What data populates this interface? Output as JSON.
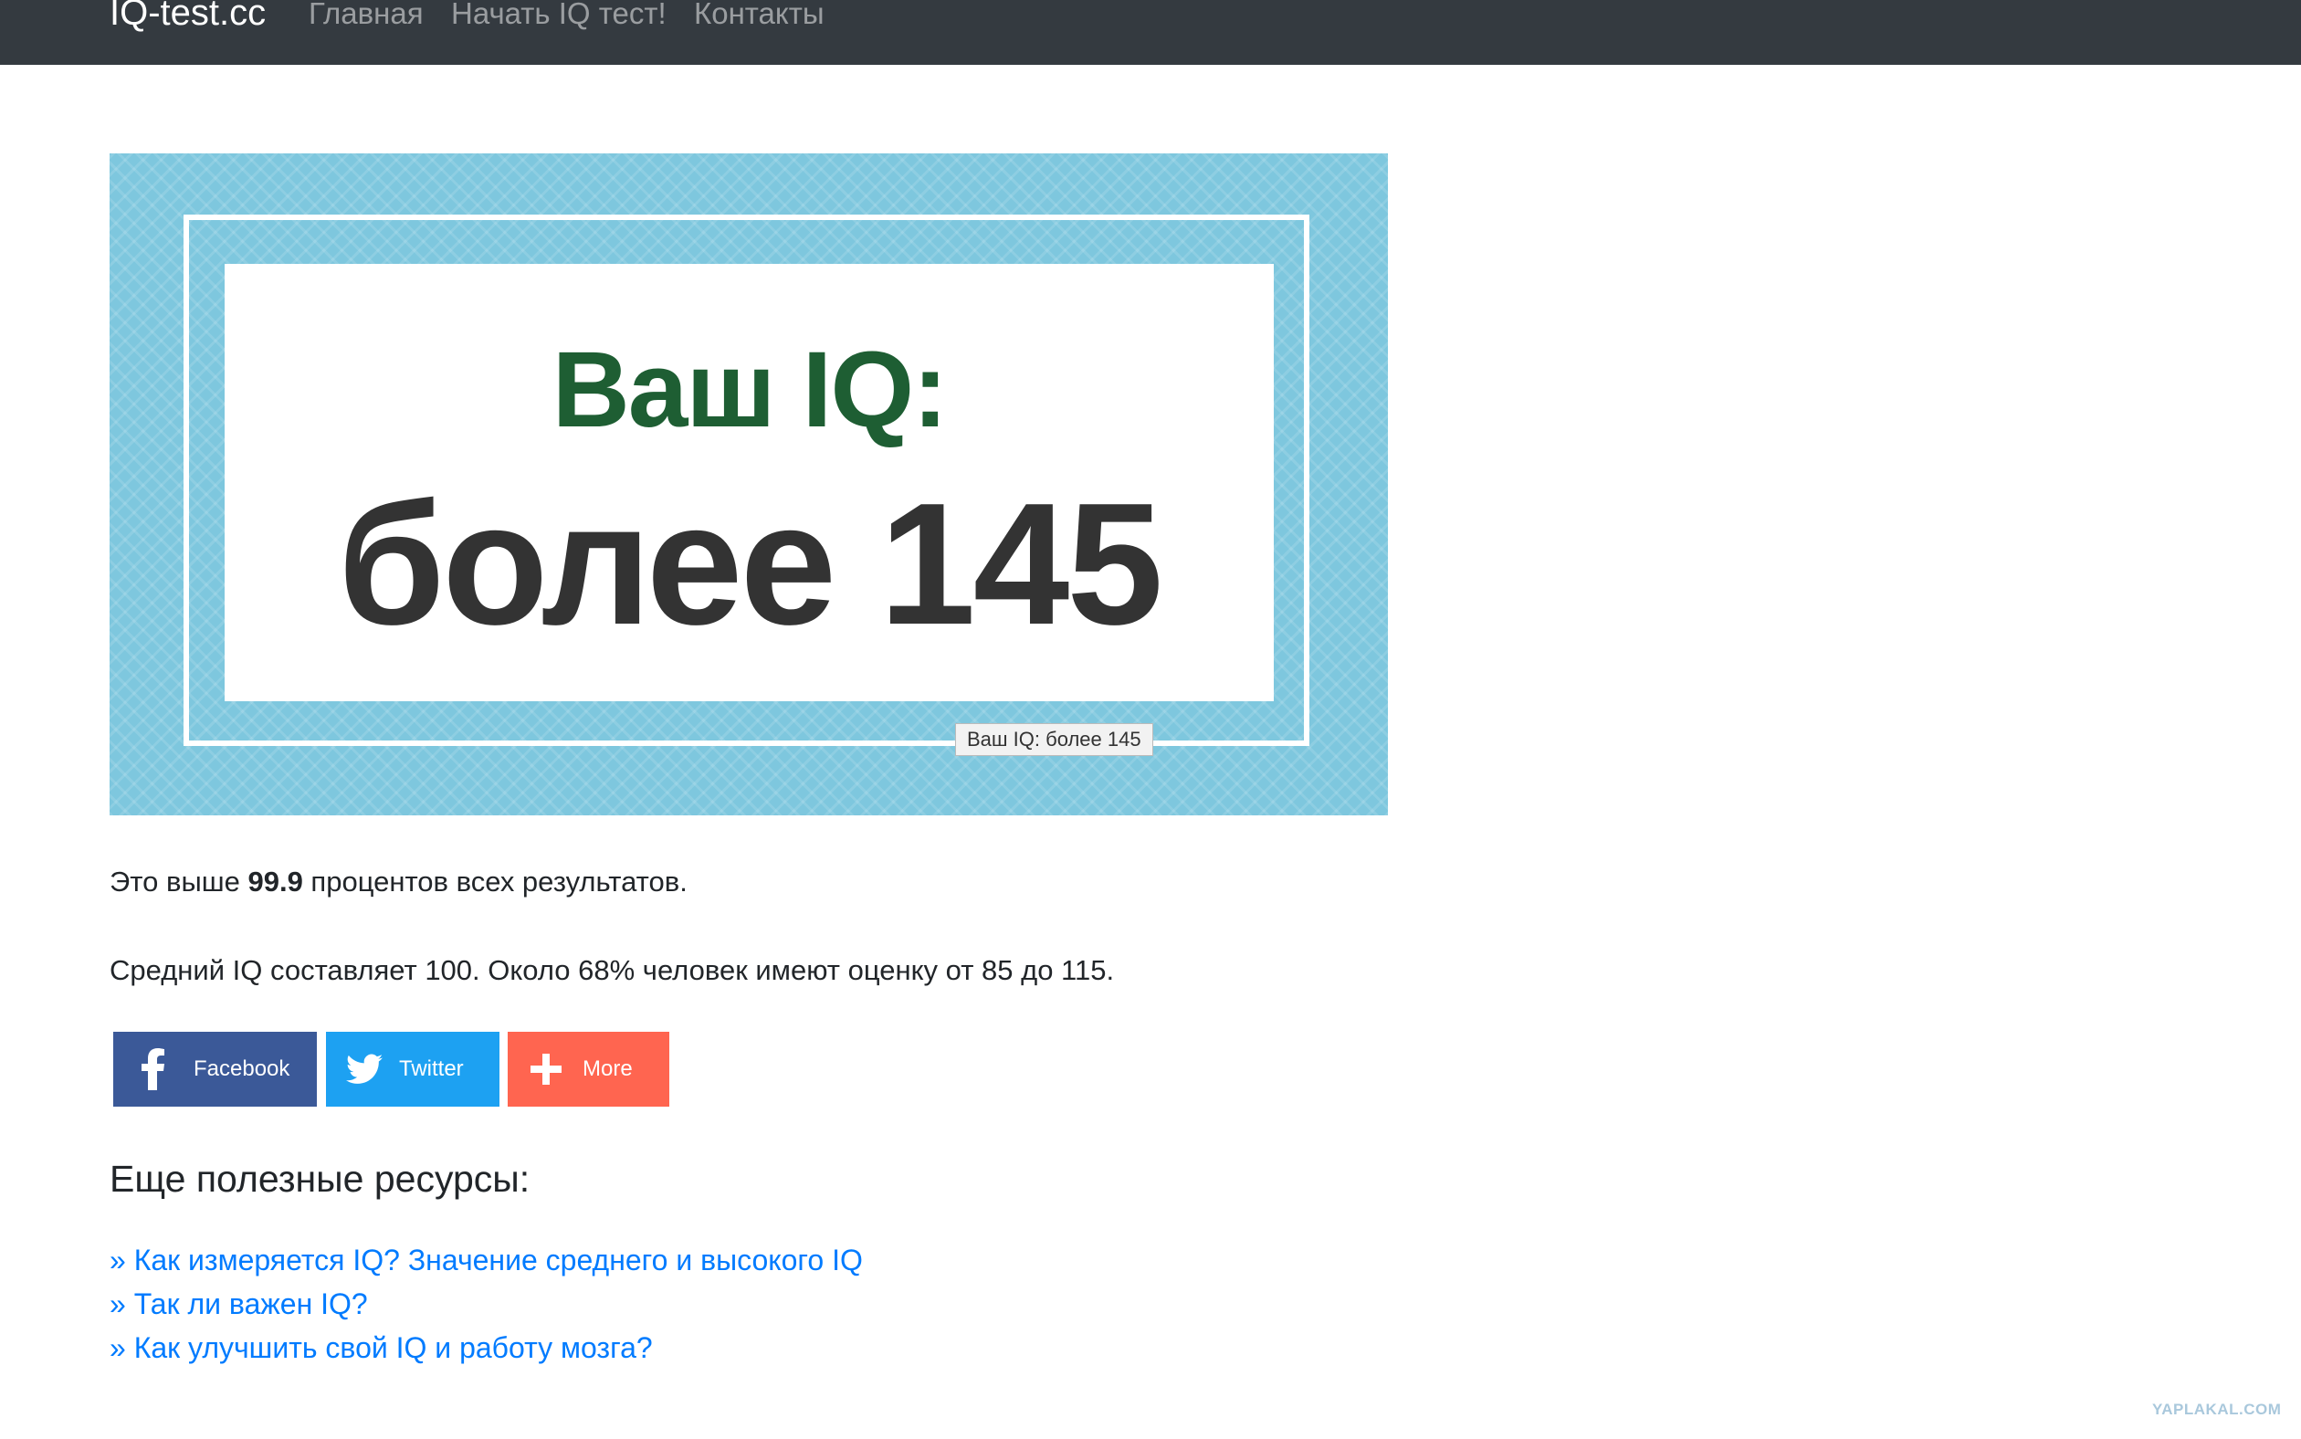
{
  "nav": {
    "brand": "IQ-test.cc",
    "links": [
      "Главная",
      "Начать IQ тест!",
      "Контакты"
    ]
  },
  "banner": {
    "line1": "Ваш IQ:",
    "line2": "более 145",
    "tooltip": "Ваш IQ: более 145",
    "bg_color": "#7ec7de",
    "line1_color": "#1e5e33"
  },
  "result": {
    "prefix": "Это выше ",
    "percent": "99.9",
    "suffix": " процентов всех результатов."
  },
  "info": "Средний IQ составляет 100. Около 68% человек имеют оценку от 85 до 115.",
  "share": [
    {
      "label": "Facebook",
      "icon": "facebook-icon",
      "color": "#3b5998"
    },
    {
      "label": "Twitter",
      "icon": "twitter-icon",
      "color": "#1da1f2"
    },
    {
      "label": "More",
      "icon": "plus-icon",
      "color": "#ff6550"
    }
  ],
  "resources": {
    "heading": "Еще полезные ресурсы:",
    "links": [
      "» Как измеряется IQ? Значение среднего и высокого IQ",
      "» Так ли важен IQ?",
      "» Как улучшить свой IQ и работу мозга?"
    ]
  },
  "watermark": "YAPLAKAL.COM"
}
